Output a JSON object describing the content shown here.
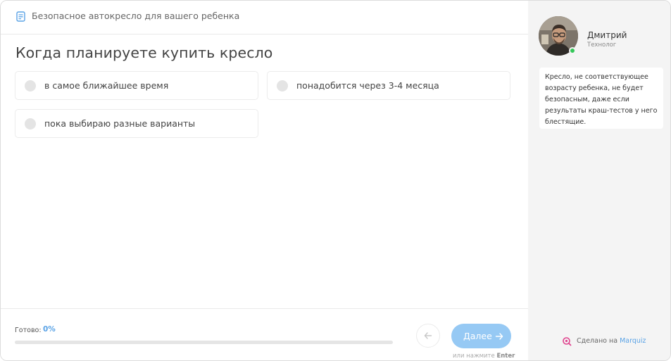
{
  "header": {
    "title": "Безопасное автокресло для вашего ребенка",
    "icon": "form-list-icon"
  },
  "question": {
    "title": "Когда планируете купить кресло"
  },
  "options": [
    {
      "label": "в самое ближайшее время",
      "selected": false
    },
    {
      "label": "понадобится через 3-4 месяца",
      "selected": false
    },
    {
      "label": "пока выбираю разные варианты",
      "selected": false
    }
  ],
  "footer": {
    "progress_label": "Готово:",
    "progress_value": "0%",
    "progress_fraction": 0,
    "back_icon": "arrow-left-icon",
    "next_label": "Далее",
    "next_icon": "arrow-right-icon",
    "hint_prefix": "или нажмите",
    "hint_key": "Enter"
  },
  "sidebar": {
    "manager_name": "Дмитрий",
    "manager_role": "Технолог",
    "online": true,
    "message_lines": [
      "Кресло, не соответствующее",
      "возрасту ребенка, не будет",
      "безопасным, даже если",
      "результаты краш-тестов у него",
      "блестящие."
    ],
    "made_by_prefix": "Сделано на",
    "made_by_brand": "Marquiz"
  },
  "colors": {
    "accent": "#5aa3e6",
    "next_button": "#96c9f4",
    "online": "#34c759",
    "sidebar_bg": "#f4f4f4",
    "brand_icon": "#e0458f"
  }
}
